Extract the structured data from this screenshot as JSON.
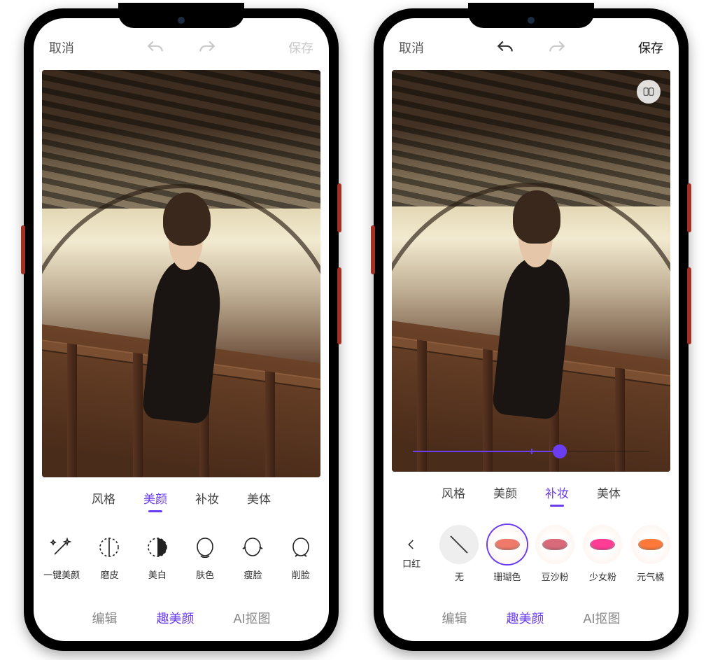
{
  "topbar": {
    "cancel": "取消",
    "save": "保存"
  },
  "subtabs": [
    "风格",
    "美颜",
    "补妆",
    "美体"
  ],
  "bottom_tabs": [
    "编辑",
    "趣美颜",
    "AI抠图"
  ],
  "left": {
    "active_subtab": 1,
    "save_enabled": false,
    "undo_enabled": false,
    "tools": [
      {
        "id": "auto",
        "label": "一键美颜"
      },
      {
        "id": "smooth",
        "label": "磨皮"
      },
      {
        "id": "whiten",
        "label": "美白"
      },
      {
        "id": "tone",
        "label": "肤色"
      },
      {
        "id": "slim",
        "label": "瘦脸"
      },
      {
        "id": "jaw",
        "label": "削脸"
      }
    ],
    "active_bottom": 1
  },
  "right": {
    "active_subtab": 2,
    "save_enabled": true,
    "undo_enabled": true,
    "slider": {
      "value": 62,
      "tick": 50
    },
    "back_label": "口红",
    "lips": [
      {
        "id": "none",
        "label": "无",
        "color": null
      },
      {
        "id": "coral",
        "label": "珊瑚色",
        "color": "#f07a6a"
      },
      {
        "id": "bean",
        "label": "豆沙粉",
        "color": "#d96a7a"
      },
      {
        "id": "girl",
        "label": "少女粉",
        "color": "#ff3d95"
      },
      {
        "id": "orange",
        "label": "元气橘",
        "color": "#ff7a3a"
      }
    ],
    "selected_lip": 1,
    "active_bottom": 1
  }
}
